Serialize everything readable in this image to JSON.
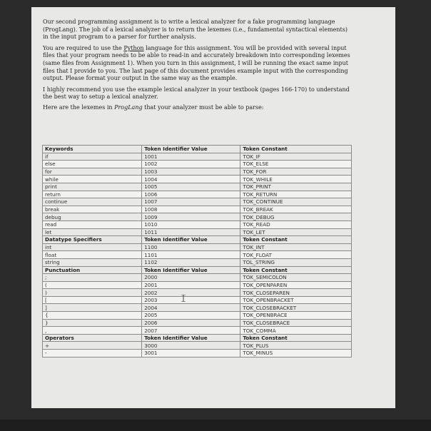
{
  "intro": {
    "p1": "Our second programming assignment is to write a lexical analyzer for a fake programming language (ProgLang). The job of a lexical analyzer is to return the lexemes (i.e., fundamental syntactical elements) in the input program to a parser for further analysis.",
    "p2_before": "You are required to use the ",
    "p2_link": "Python",
    "p2_after": " language for this assignment. You will be provided with several input files that your program needs to be able to read-in and accurately breakdown into corresponding lexemes (same files from Assignment 1). When you turn in this assignment, I will be running the exact same input files that I provide to you. The last page of this document provides example input with the corresponding output. Please format your output in the same way as the example.",
    "p3": "I highly recommend you use the example lexical analyzer in your textbook (pages 166-170) to understand the best way to setup a lexical analyzer.",
    "p4_before": "Here are the lexemes in ",
    "p4_em": "ProgLang",
    "p4_after": " that your analyzer must be able to parse:"
  },
  "table": {
    "sections": [
      {
        "header": [
          "Keywords",
          "Token Identifier Value",
          "Token Constant"
        ],
        "rows": [
          [
            "if",
            "1001",
            "TOK_IF"
          ],
          [
            "else",
            "1002",
            "TOK_ELSE"
          ],
          [
            "for",
            "1003",
            "TOK_FOR"
          ],
          [
            "while",
            "1004",
            "TOK_WHILE"
          ],
          [
            "print",
            "1005",
            "TOK_PRINT"
          ],
          [
            "return",
            "1006",
            "TOK_RETURN"
          ],
          [
            "continue",
            "1007",
            "TOK_CONTINUE"
          ],
          [
            "break",
            "1008",
            "TOK_BREAK"
          ],
          [
            "debug",
            "1009",
            "TOK_DEBUG"
          ],
          [
            "read",
            "1010",
            "TOK_READ"
          ],
          [
            "let",
            "1011",
            "TOK_LET"
          ]
        ]
      },
      {
        "header": [
          "Datatype Specifiers",
          "Token Identifier Value",
          "Token Constant"
        ],
        "rows": [
          [
            "int",
            "1100",
            "TOK_INT"
          ],
          [
            "float",
            "1101",
            "TOK_FLOAT"
          ],
          [
            "string",
            "1102",
            "TOL_STRING"
          ]
        ]
      },
      {
        "header": [
          "Punctuation",
          "Token Identifier Value",
          "Token Constant"
        ],
        "rows": [
          [
            ";",
            "2000",
            "TOK_SEMICOLON"
          ],
          [
            "(",
            "2001",
            "TOK_OPENPAREN"
          ],
          [
            ")",
            "2002",
            "TOK_CLOSEPAREN"
          ],
          [
            "[",
            "2003",
            "TOK_OPENBRACKET"
          ],
          [
            "]",
            "2004",
            "TOK_CLOSEBRACKET"
          ],
          [
            "{",
            "2005",
            "TOK_OPENBRACE"
          ],
          [
            "}",
            "2006",
            "TOK_CLOSEBRACE"
          ],
          [
            ",",
            "2007",
            "TOK_COMMA"
          ]
        ]
      },
      {
        "header": [
          "Operators",
          "Token Identifier Value",
          "Token Constant"
        ],
        "rows": [
          [
            "+",
            "3000",
            "TOK_PLUS"
          ],
          [
            "-",
            "3001",
            "TOK_MINUS"
          ]
        ]
      }
    ]
  }
}
